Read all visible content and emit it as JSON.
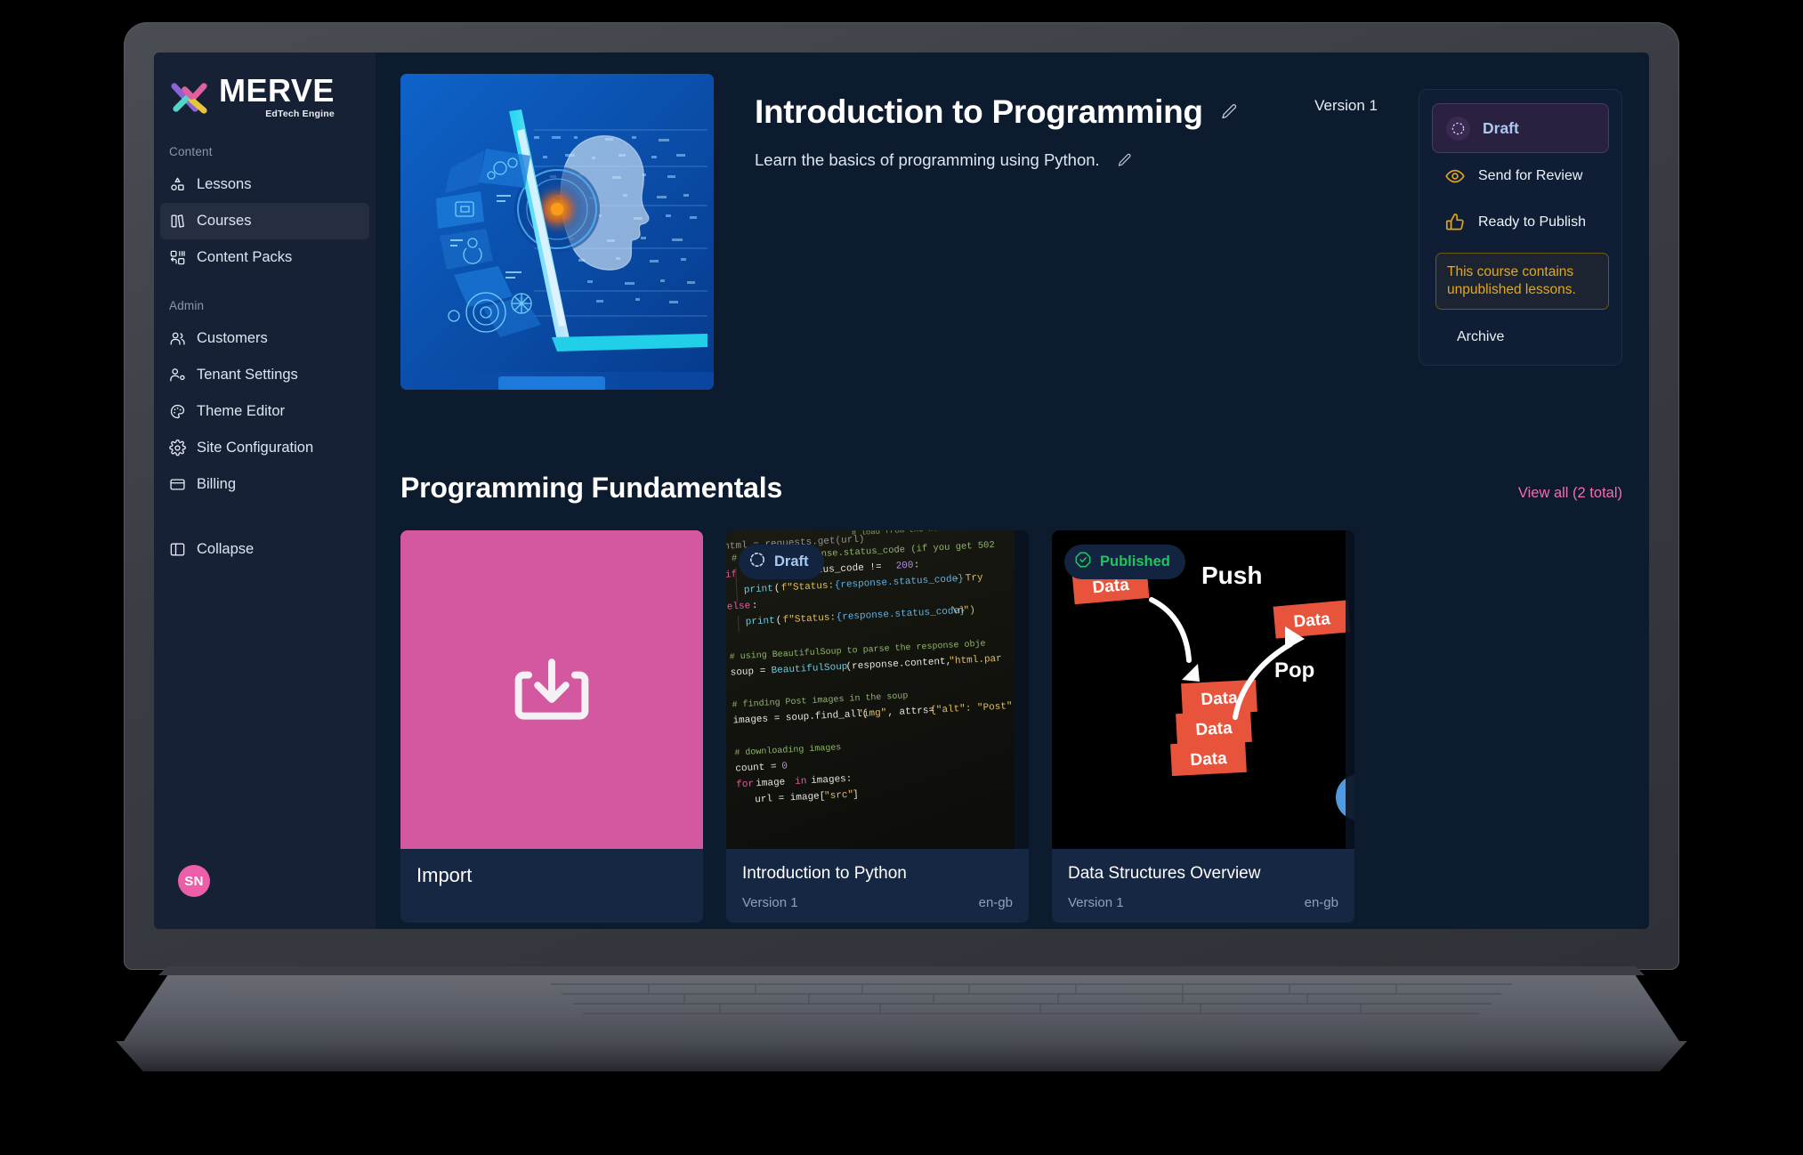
{
  "brand": {
    "name": "MERVE",
    "tagline": "EdTech Engine"
  },
  "sidebar": {
    "groups": [
      {
        "label": "Content",
        "items": [
          {
            "label": "Lessons",
            "icon": "lessons-icon",
            "active": false
          },
          {
            "label": "Courses",
            "icon": "courses-icon",
            "active": true
          },
          {
            "label": "Content Packs",
            "icon": "content-packs-icon",
            "active": false
          }
        ]
      },
      {
        "label": "Admin",
        "items": [
          {
            "label": "Customers",
            "icon": "customers-icon",
            "active": false
          },
          {
            "label": "Tenant Settings",
            "icon": "tenant-settings-icon",
            "active": false
          },
          {
            "label": "Theme Editor",
            "icon": "theme-editor-icon",
            "active": false
          },
          {
            "label": "Site Configuration",
            "icon": "site-configuration-icon",
            "active": false
          },
          {
            "label": "Billing",
            "icon": "billing-icon",
            "active": false
          }
        ]
      }
    ],
    "collapse": {
      "label": "Collapse",
      "icon": "panel-collapse-icon"
    },
    "avatar_initials": "SN"
  },
  "header": {
    "title": "Introduction to Programming",
    "description": "Learn the basics of programming using Python.",
    "version": "Version 1",
    "edit_title_icon": "pencil-icon",
    "edit_description_icon": "pencil-icon"
  },
  "status_panel": {
    "draft": {
      "label": "Draft",
      "icon": "dashed-circle-icon"
    },
    "actions": [
      {
        "label": "Send for Review",
        "icon": "eye-icon"
      },
      {
        "label": "Ready to Publish",
        "icon": "thumbs-up-icon"
      }
    ],
    "warning": "This course contains unpublished lessons.",
    "archive": {
      "label": "Archive",
      "icon": "trash-icon"
    }
  },
  "section": {
    "title": "Programming Fundamentals",
    "view_all": "View all (2 total)"
  },
  "cards": [
    {
      "type": "import",
      "title": "Import",
      "icon": "download-tray-icon"
    },
    {
      "type": "lesson",
      "title": "Introduction to Python",
      "badge": "Draft",
      "badge_icon": "dashed-circle-icon",
      "version": "Version 1",
      "locale": "en-gb"
    },
    {
      "type": "lesson",
      "title": "Data Structures Overview",
      "badge": "Published",
      "badge_icon": "check-octagon-icon",
      "version": "Version 1",
      "locale": "en-gb"
    }
  ],
  "colors": {
    "main_bg": "#0d1b2f",
    "sidebar_bg": "#172135",
    "accent_pink": "#ec5fa8",
    "link_pink": "#f06fb0",
    "warning_amber": "#e3a81b",
    "published_green": "#1fc45e",
    "draft_blue": "#a9c9f2",
    "import_pink": "#d4589f"
  }
}
